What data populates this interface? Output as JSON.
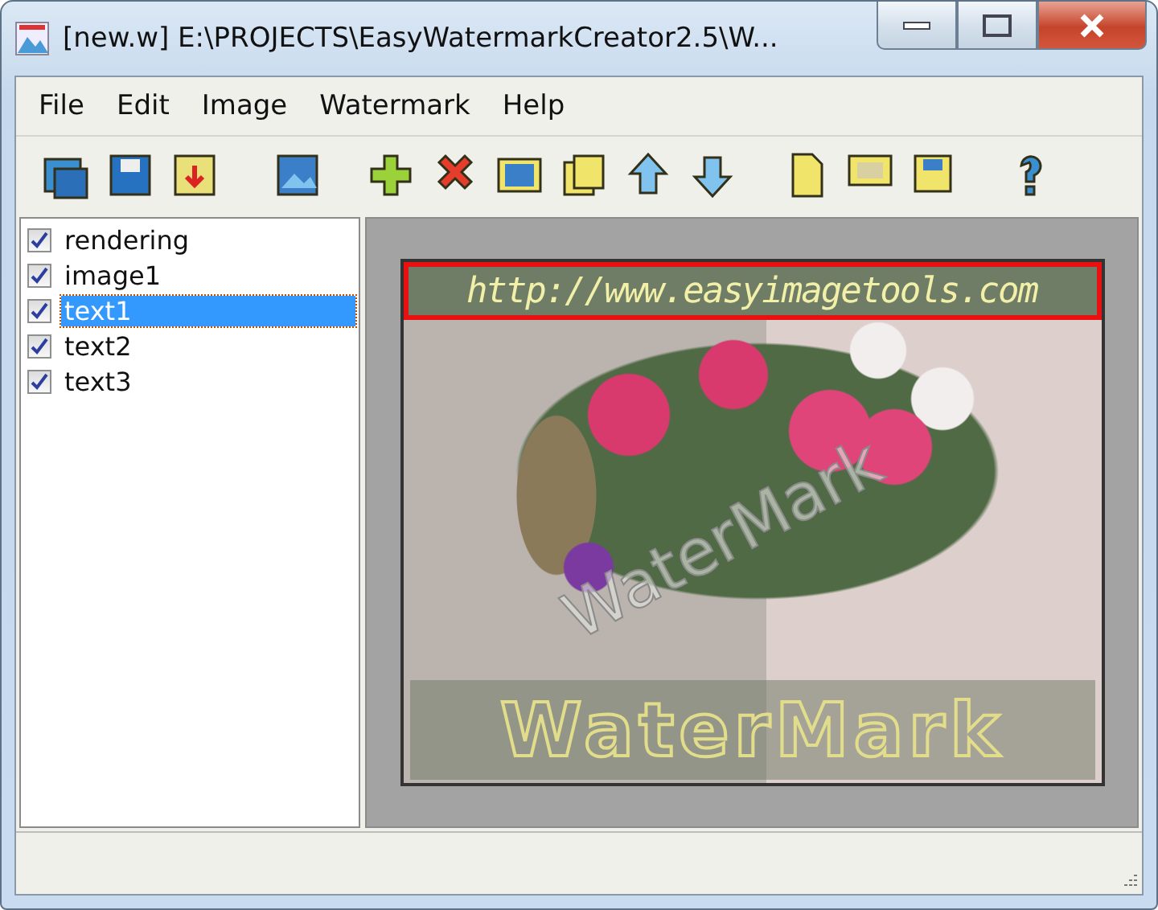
{
  "window": {
    "title": "[new.w] E:\\PROJECTS\\EasyWatermarkCreator2.5\\W..."
  },
  "menu": [
    "File",
    "Edit",
    "Image",
    "Watermark",
    "Help"
  ],
  "layers": [
    {
      "label": "rendering",
      "checked": true,
      "selected": false
    },
    {
      "label": "image1",
      "checked": true,
      "selected": false
    },
    {
      "label": "text1",
      "checked": true,
      "selected": true
    },
    {
      "label": "text2",
      "checked": true,
      "selected": false
    },
    {
      "label": "text3",
      "checked": true,
      "selected": false
    }
  ],
  "preview_texts": [
    {
      "kind": "url",
      "text": "http://www.easyimagetools.com",
      "selected": true
    },
    {
      "kind": "diagonal",
      "text": "WaterMark",
      "selected": false
    },
    {
      "kind": "banner",
      "text": "WaterMark",
      "selected": false
    }
  ]
}
